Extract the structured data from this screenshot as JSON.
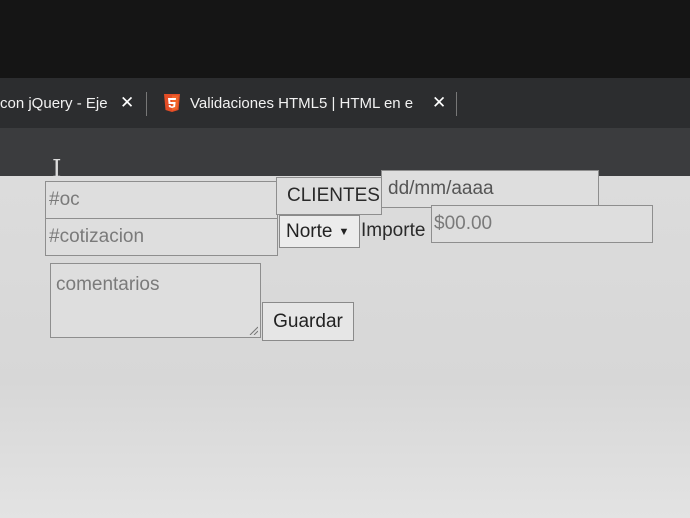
{
  "browser": {
    "tabs": [
      {
        "title": "con jQuery - Eje",
        "active": false
      },
      {
        "title": "Validaciones HTML5 | HTML en e",
        "active": true,
        "icon": "html5-icon"
      }
    ],
    "close_glyph": "✕",
    "new_tab_glyph": "+",
    "cursor_glyph": "I"
  },
  "form": {
    "oc_placeholder": "#oc",
    "clientes_label": "CLIENTES",
    "date_placeholder": "dd/mm/aaaa",
    "cotizacion_placeholder": "#cotizacion",
    "region_selected": "Norte",
    "caret": "▼",
    "importe_label": "Importe",
    "importe_placeholder": "$00.00",
    "comentarios_placeholder": "comentarios",
    "guardar_label": "Guardar"
  },
  "colors": {
    "html5_orange": "#e44d26",
    "tabbar": "#2c2d2f",
    "page_bg": "#d9d9d9"
  }
}
